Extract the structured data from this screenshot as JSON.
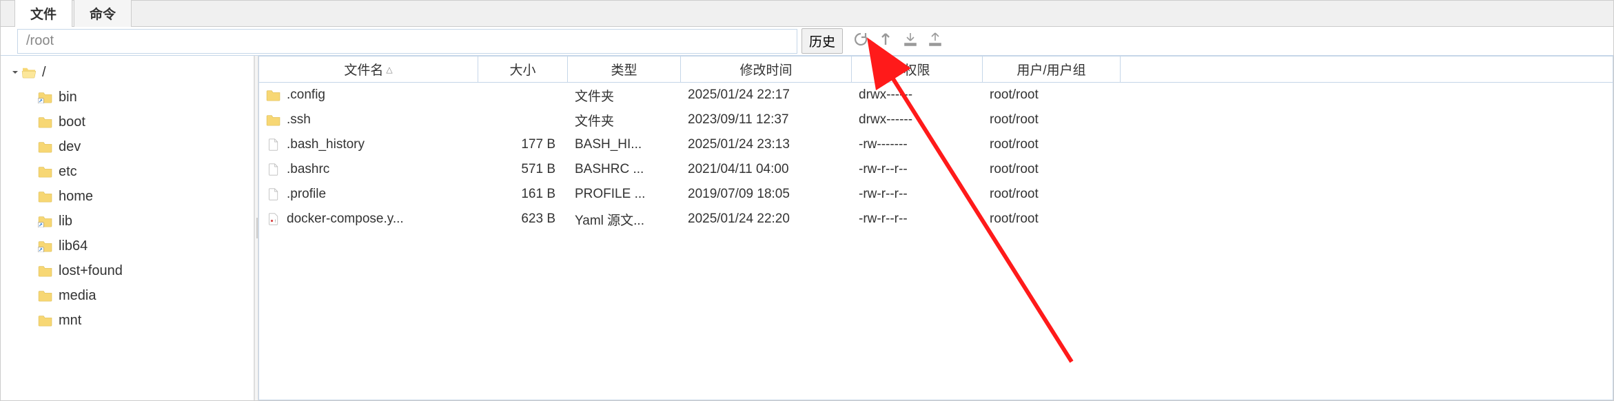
{
  "tabs": {
    "file": "文件",
    "command": "命令"
  },
  "path": {
    "value": "/root",
    "history_label": "历史"
  },
  "tree": {
    "root_label": "/",
    "items": [
      {
        "label": "bin",
        "link": true
      },
      {
        "label": "boot",
        "link": false
      },
      {
        "label": "dev",
        "link": false
      },
      {
        "label": "etc",
        "link": false
      },
      {
        "label": "home",
        "link": false
      },
      {
        "label": "lib",
        "link": true
      },
      {
        "label": "lib64",
        "link": true
      },
      {
        "label": "lost+found",
        "link": false
      },
      {
        "label": "media",
        "link": false
      },
      {
        "label": "mnt",
        "link": false
      }
    ]
  },
  "columns": {
    "name": "文件名",
    "size": "大小",
    "type": "类型",
    "mtime": "修改时间",
    "perm": "权限",
    "user": "用户/用户组"
  },
  "files": [
    {
      "name": ".config",
      "size": "",
      "type": "文件夹",
      "mtime": "2025/01/24 22:17",
      "perm": "drwx------",
      "user": "root/root",
      "icon": "folder"
    },
    {
      "name": ".ssh",
      "size": "",
      "type": "文件夹",
      "mtime": "2023/09/11 12:37",
      "perm": "drwx------",
      "user": "root/root",
      "icon": "folder"
    },
    {
      "name": ".bash_history",
      "size": "177 B",
      "type": "BASH_HI...",
      "mtime": "2025/01/24 23:13",
      "perm": "-rw-------",
      "user": "root/root",
      "icon": "file"
    },
    {
      "name": ".bashrc",
      "size": "571 B",
      "type": "BASHRC ...",
      "mtime": "2021/04/11 04:00",
      "perm": "-rw-r--r--",
      "user": "root/root",
      "icon": "file"
    },
    {
      "name": ".profile",
      "size": "161 B",
      "type": "PROFILE ...",
      "mtime": "2019/07/09 18:05",
      "perm": "-rw-r--r--",
      "user": "root/root",
      "icon": "file"
    },
    {
      "name": "docker-compose.y...",
      "size": "623 B",
      "type": "Yaml 源文...",
      "mtime": "2025/01/24 22:20",
      "perm": "-rw-r--r--",
      "user": "root/root",
      "icon": "yaml"
    }
  ]
}
